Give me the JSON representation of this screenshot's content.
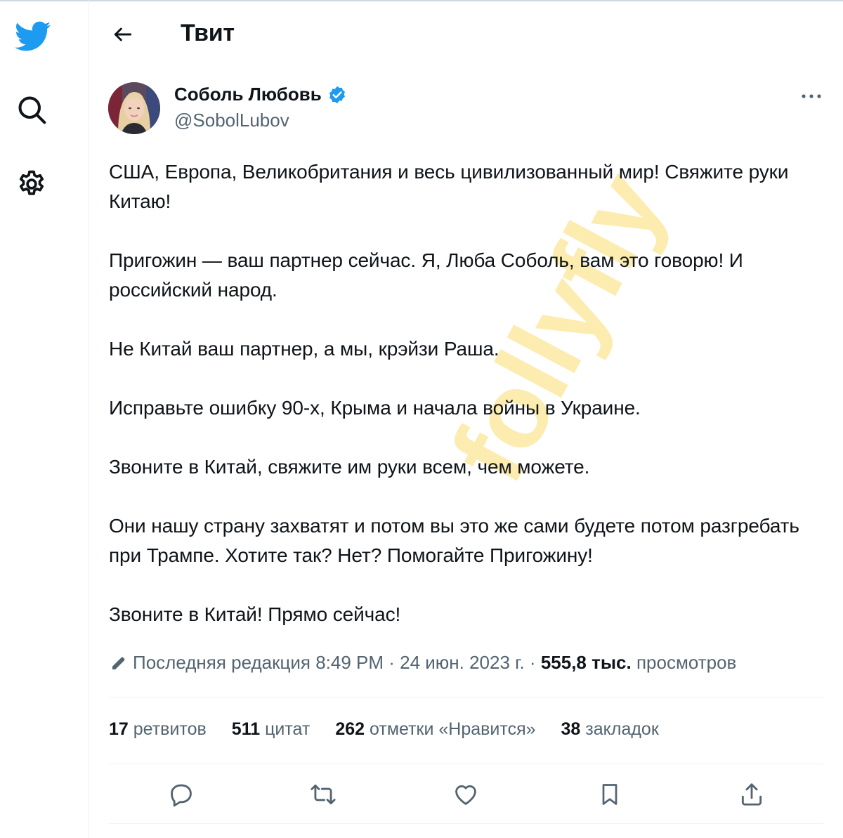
{
  "header": {
    "title": "Твит"
  },
  "author": {
    "name": "Соболь Любовь",
    "handle": "@SobolLubov",
    "verified": true
  },
  "tweet": {
    "paragraphs": [
      "США, Европа, Великобритания и весь цивилизованный мир! Свяжите руки Китаю!",
      "Пригожин — ваш партнер сейчас. Я, Люба Соболь, вам это говорю! И российский народ.",
      "Не Китай ваш партнер, а мы, крэйзи Раша.",
      "Исправьте ошибку 90-х, Крыма и начала войны в Украине.",
      "Звоните в Китай, свяжите им руки всем, чем можете.",
      "Они нашу страну захватят и потом вы это же сами будете потом разгребать при Трампе. Хотите так? Нет? Помогайте Пригожину!",
      "Звоните в Китай! Прямо сейчас!"
    ]
  },
  "watermark": "follyfly",
  "meta": {
    "edited_label": "Последняя редакция 8:49 PM · 24 июн. 2023 г. · ",
    "views_count": "555,8 тыс.",
    "views_label": " просмотров"
  },
  "stats": [
    {
      "count": "17",
      "label": " ретвитов"
    },
    {
      "count": "511",
      "label": " цитат"
    },
    {
      "count": "262",
      "label": " отметки «Нравится»"
    },
    {
      "count": "38",
      "label": " закладок"
    }
  ],
  "icons": {
    "logo": "twitter-bird-icon",
    "search": "search-icon",
    "settings": "gear-icon",
    "back": "arrow-left-icon",
    "more": "more-horizontal-icon",
    "verified": "verified-badge-icon",
    "edit": "pencil-icon",
    "reply": "reply-icon",
    "retweet": "retweet-icon",
    "like": "heart-icon",
    "bookmark": "bookmark-icon",
    "share": "share-icon"
  },
  "colors": {
    "brand": "#1d9bf0",
    "text": "#0f1419",
    "secondary": "#536471",
    "watermark": "#fde9a3"
  }
}
